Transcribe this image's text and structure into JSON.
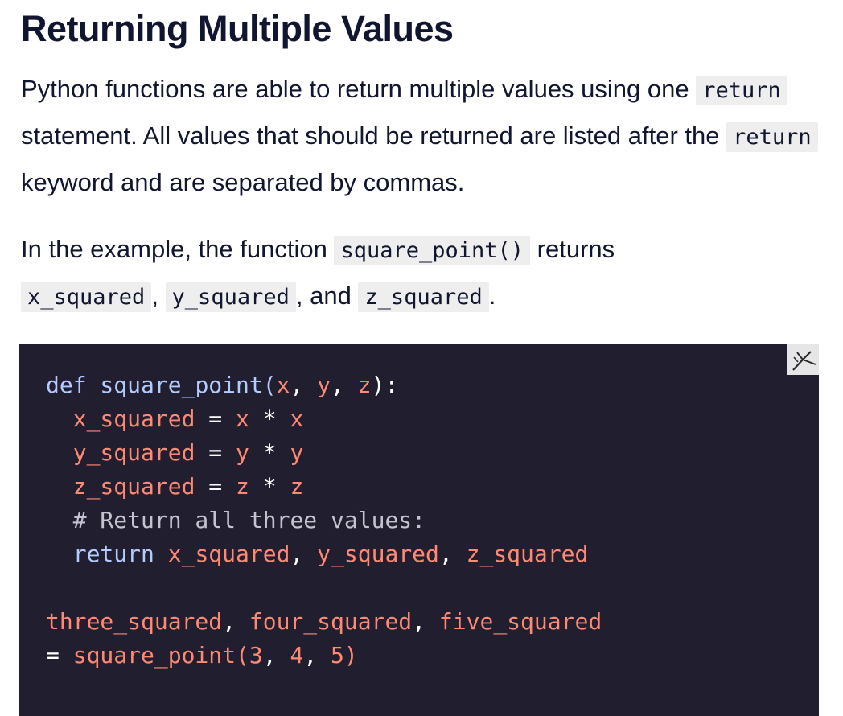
{
  "heading": "Returning Multiple Values",
  "paragraph1": {
    "t1": "Python functions are able to return multiple values using one ",
    "c1": "return",
    "t2": " statement. All values that should be returned are listed after the ",
    "c2": "return",
    "t3": " keyword and are separated by commas."
  },
  "paragraph2": {
    "t1": "In the example, the function ",
    "c1": "square_point()",
    "t2": " returns ",
    "c2": "x_squared",
    "t3": ", ",
    "c3": "y_squared",
    "t4": ", and ",
    "c4": "z_squared",
    "t5": "."
  },
  "code": {
    "line1": {
      "kw": "def",
      "fn": " square_point(",
      "a": "x",
      "s1": ", ",
      "b": "y",
      "s2": ", ",
      "c": "z",
      "end": "):"
    },
    "line2": {
      "v": "x_squared",
      "op": " = ",
      "a": "x",
      "mul": " * ",
      "b": "x"
    },
    "line3": {
      "v": "y_squared",
      "op": " = ",
      "a": "y",
      "mul": " * ",
      "b": "y"
    },
    "line4": {
      "v": "z_squared",
      "op": " = ",
      "a": "z",
      "mul": " * ",
      "b": "z"
    },
    "line5": {
      "comment": "# Return all three values:"
    },
    "line6": {
      "kw": "return",
      "sp": " ",
      "a": "x_squared",
      "s1": ", ",
      "b": "y_squared",
      "s2": ", ",
      "c": "z_squared"
    },
    "line8": {
      "a": "three_squared",
      "s1": ", ",
      "b": "four_squared",
      "s2": ", ",
      "c": "five_squared"
    },
    "line9": {
      "eq": "= ",
      "fn": "square_point(",
      "a": "3",
      "s1": ", ",
      "b": "4",
      "s2": ", ",
      "c": "5",
      "end": ")"
    }
  },
  "icons": {
    "expand": "expand-icon"
  },
  "colors": {
    "text": "#10162f",
    "code_bg": "#211e2f",
    "keyword": "#b3ccff",
    "variable": "#ff8973",
    "comment": "#c6c3d0",
    "inline_code_bg": "#eeeeee"
  }
}
